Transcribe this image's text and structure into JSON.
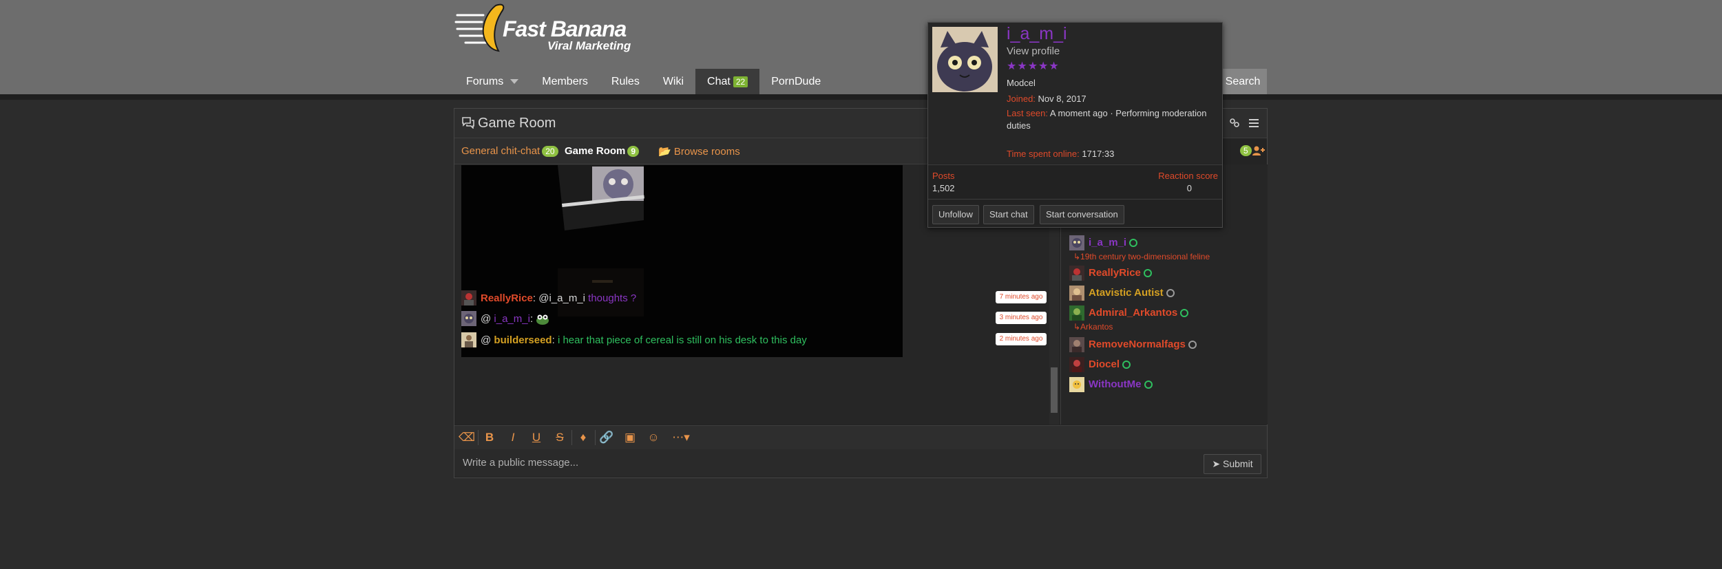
{
  "header": {
    "logo_title": "Fast Banana",
    "logo_subtitle": "Viral Marketing",
    "nav": [
      {
        "label": "Forums"
      },
      {
        "label": "Members"
      },
      {
        "label": "Rules"
      },
      {
        "label": "Wiki"
      },
      {
        "label": "Chat",
        "badge": "22"
      },
      {
        "label": "PornDude"
      }
    ],
    "search_label": "Search"
  },
  "chat": {
    "title": "Game Room",
    "rooms": [
      {
        "label": "General chit-chat",
        "badge": "20"
      },
      {
        "label": "Game Room",
        "badge": "9"
      },
      {
        "label": "Browse rooms"
      }
    ],
    "users_badge": "5",
    "messages": [
      {
        "user": "ReallyRice",
        "sep": ": ",
        "mention": "@i_a_m_i",
        "text": " thoughts ?",
        "time": "7 minutes ago"
      },
      {
        "prefix": "@ ",
        "user": "i_a_m_i",
        "sep": ": ",
        "text": "",
        "time": "3 minutes ago"
      },
      {
        "prefix": "@ ",
        "user": "builderseed",
        "sep": ": ",
        "text": "i hear that piece of cereal is still on his desk to this day",
        "time": "2 minutes ago"
      }
    ],
    "composer_placeholder": "Write a public message...",
    "submit_label": "Submit"
  },
  "userlist": [
    {
      "name": "i_a_m_i",
      "status": "↳19th century two-dimensional feline",
      "dot": "green"
    },
    {
      "name": "ReallyRice",
      "dot": "green"
    },
    {
      "name": "Atavistic Autist",
      "dot": "grey"
    },
    {
      "name": "Admiral_Arkantos",
      "status": "↳Arkantos",
      "dot": "green"
    },
    {
      "name": "RemoveNormalfags",
      "dot": "grey"
    },
    {
      "name": "Diocel",
      "dot": "green"
    },
    {
      "name": "WithoutMe",
      "dot": "green"
    }
  ],
  "profile": {
    "name": "i_a_m_i",
    "view_profile": "View profile",
    "stars": "★★★★★",
    "title": "Modcel",
    "joined_label": "Joined:",
    "joined": "Nov 8, 2017",
    "last_seen_label": "Last seen:",
    "last_seen_line1": "A moment ago · Performing moderation",
    "last_seen_line2": "duties",
    "time_online_label": "Time spent online:",
    "time_online": "1717:33",
    "posts_label": "Posts",
    "posts": "1,502",
    "reaction_label": "Reaction score",
    "reaction": "0",
    "buttons": [
      "Unfollow",
      "Start chat",
      "Start conversation"
    ]
  },
  "colors": {
    "header": "#6d6d6d",
    "accent_orange": "#e8944a",
    "badge_green": "#8fc142",
    "purple": "#8a36c4",
    "red": "#e04a2a"
  }
}
